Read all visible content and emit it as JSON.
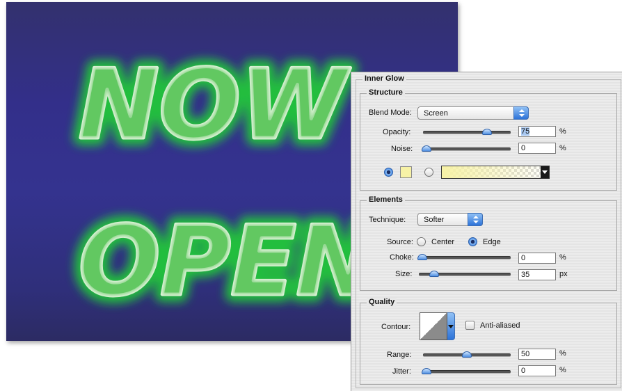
{
  "artwork": {
    "line1": "NOW",
    "line2": "OPEN",
    "glow_color": "#5fd160",
    "background_color": "#33318a"
  },
  "panel": {
    "title": "Inner Glow",
    "structure": {
      "legend": "Structure",
      "blend_mode_label": "Blend Mode:",
      "blend_mode_value": "Screen",
      "opacity_label": "Opacity:",
      "opacity_value": "75",
      "opacity_unit": "%",
      "opacity_level": 0.75,
      "noise_label": "Noise:",
      "noise_value": "0",
      "noise_unit": "%",
      "noise_level": 0,
      "glow_color_swatch": "#f7f2a6",
      "gradient_start": "#f7f2a6"
    },
    "elements": {
      "legend": "Elements",
      "technique_label": "Technique:",
      "technique_value": "Softer",
      "source_label": "Source:",
      "source_center": "Center",
      "source_edge": "Edge",
      "source_selected": "Edge",
      "choke_label": "Choke:",
      "choke_value": "0",
      "choke_unit": "%",
      "choke_level": 0,
      "size_label": "Size:",
      "size_value": "35",
      "size_unit": "px",
      "size_level": 0.14
    },
    "quality": {
      "legend": "Quality",
      "contour_label": "Contour:",
      "anti_aliased_label": "Anti-aliased",
      "anti_aliased_checked": false,
      "range_label": "Range:",
      "range_value": "50",
      "range_unit": "%",
      "range_level": 0.5,
      "jitter_label": "Jitter:",
      "jitter_value": "0",
      "jitter_unit": "%",
      "jitter_level": 0
    }
  }
}
